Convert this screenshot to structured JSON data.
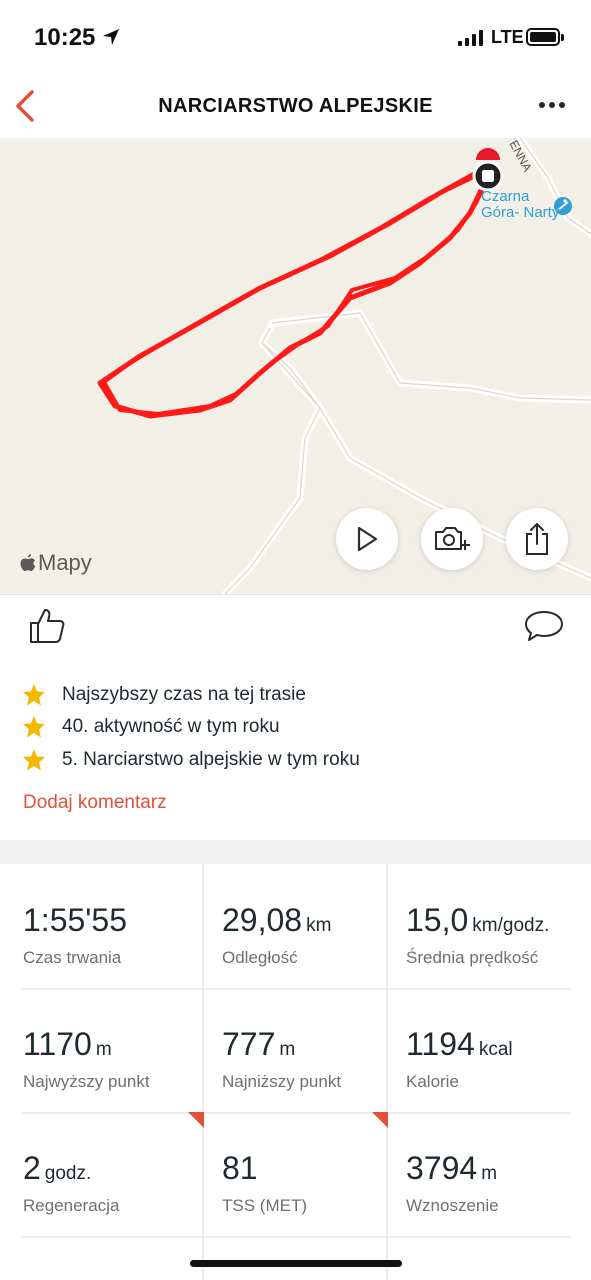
{
  "status": {
    "time": "10:25",
    "network": "LTE"
  },
  "nav": {
    "title": "NARCIARSTWO ALPEJSKIE"
  },
  "map": {
    "poi_label": "Czarna Góra- Narty",
    "street_label": "ENNA",
    "attribution": "Mapy",
    "route_color": "#ff1a1a"
  },
  "achievements": [
    {
      "icon": "star-icon",
      "text": "Najszybszy czas na tej trasie"
    },
    {
      "icon": "star-icon",
      "text": "40. aktywność w tym roku"
    },
    {
      "icon": "star-icon",
      "text": "5. Narciarstwo alpejskie w tym roku"
    }
  ],
  "add_comment": "Dodaj komentarz",
  "stats": [
    {
      "value": "1:55'55",
      "unit": "",
      "label": "Czas trwania"
    },
    {
      "value": "29,08",
      "unit": "km",
      "label": "Odległość"
    },
    {
      "value": "15,0",
      "unit": "km/godz.",
      "label": "Średnia prędkość"
    },
    {
      "value": "1170",
      "unit": "m",
      "label": "Najwyższy punkt"
    },
    {
      "value": "777",
      "unit": "m",
      "label": "Najniższy punkt"
    },
    {
      "value": "1194",
      "unit": "kcal",
      "label": "Kalorie"
    },
    {
      "value": "2",
      "unit": "godz.",
      "label": "Regeneracja"
    },
    {
      "value": "81",
      "unit": "",
      "label": "TSS (MET)"
    },
    {
      "value": "3794",
      "unit": "m",
      "label": "Wznoszenie"
    }
  ],
  "colors": {
    "accent": "#e2503a",
    "star": "#f5b800",
    "poi": "#2f9fd6"
  }
}
